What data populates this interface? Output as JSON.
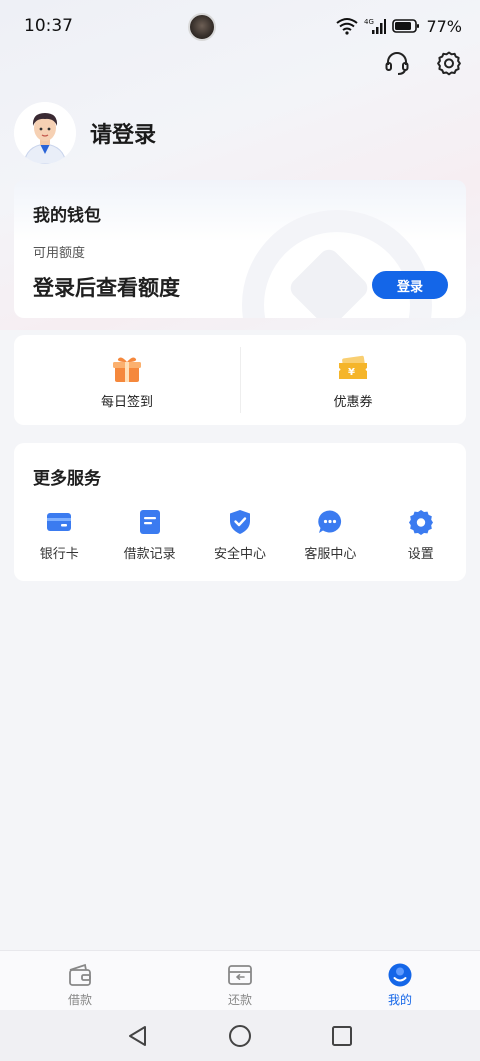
{
  "status": {
    "time": "10:37",
    "battery": "77%",
    "network": "4G"
  },
  "header": {
    "icons": [
      "headset-icon",
      "settings-gear-icon"
    ]
  },
  "user": {
    "name": "请登录"
  },
  "wallet": {
    "title": "我的钱包",
    "subtitle": "可用额度",
    "amount_text": "登录后查看额度",
    "login_button": "登录"
  },
  "quick": [
    {
      "label": "每日签到",
      "icon": "gift-icon"
    },
    {
      "label": "优惠券",
      "icon": "coupon-icon"
    }
  ],
  "services": {
    "title": "更多服务",
    "items": [
      {
        "label": "银行卡",
        "icon": "bank-card-icon"
      },
      {
        "label": "借款记录",
        "icon": "loan-record-icon"
      },
      {
        "label": "安全中心",
        "icon": "security-shield-icon"
      },
      {
        "label": "客服中心",
        "icon": "customer-service-chat-icon"
      },
      {
        "label": "设置",
        "icon": "settings-icon"
      }
    ]
  },
  "tabs": [
    {
      "label": "借款",
      "icon": "wallet-icon"
    },
    {
      "label": "还款",
      "icon": "repay-icon"
    },
    {
      "label": "我的",
      "icon": "profile-icon",
      "active": true
    }
  ],
  "colors": {
    "accent": "#1466e8",
    "icon_blue": "#3b7bf0",
    "gift_orange": "#f5883c",
    "coupon_yellow": "#f5b52a"
  }
}
